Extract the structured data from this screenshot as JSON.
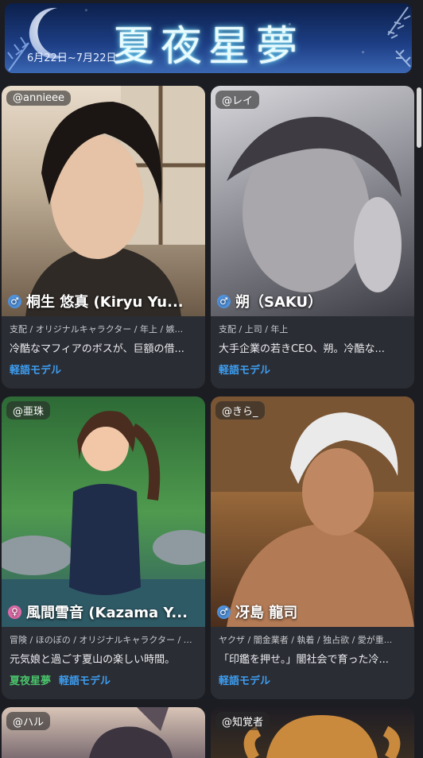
{
  "banner": {
    "title": "夏夜星夢",
    "date_range": "6月22日~7月22日"
  },
  "cards": [
    {
      "creator": "@annieee",
      "gender": "male",
      "name": "桐生 悠真 (Kiryu Yu...",
      "tags": "支配 / オリジナルキャラクター / 年上 / 嫉...",
      "description": "冷酷なマフィアのボスが、巨額の借...",
      "badges": [
        "軽語モデル"
      ]
    },
    {
      "creator": "@レイ",
      "gender": "male",
      "name": "朔（SAKU）",
      "tags": "支配 / 上司 / 年上",
      "description": "大手企業の若きCEO、朔。冷酷な...",
      "badges": [
        "軽語モデル"
      ]
    },
    {
      "creator": "@亜珠",
      "gender": "female",
      "name": "風間雪音 (Kazama Y...",
      "tags": "冒険 / ほのぼの / オリジナルキャラクター / 年...",
      "description": "元気娘と過ごす夏山の楽しい時間。",
      "badges": [
        "夏夜星夢",
        "軽語モデル"
      ]
    },
    {
      "creator": "@きら_",
      "gender": "male",
      "name": "冴島 龍司",
      "tags": "ヤクザ / 闇金業者 / 執着 / 独占欲 / 愛が重...",
      "description": "「印鑑を押せ。」闇社会で育った冷...",
      "badges": [
        "軽語モデル"
      ]
    },
    {
      "creator": "@ハル"
    },
    {
      "creator": "@知覚者"
    }
  ],
  "icons": {
    "male": "♂",
    "female": "♀"
  }
}
